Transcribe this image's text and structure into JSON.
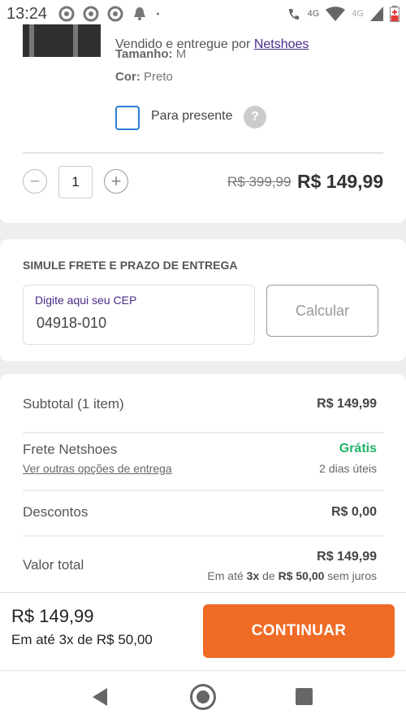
{
  "status_bar": {
    "time": "13:24",
    "network_label_1": "4G",
    "network_label_2": "4G",
    "icons": [
      "chrome-icon",
      "chrome-icon",
      "chrome-icon",
      "notification-bell-icon",
      "dot-icon",
      "wifi-call-icon",
      "wifi-icon",
      "signal-icon",
      "battery-low-icon"
    ]
  },
  "product": {
    "seller_prefix": "Vendido e entregue por ",
    "seller_name": "Netshoes",
    "size_label": "Tamanho:",
    "size_value": "M",
    "color_label": "Cor:",
    "color_value": "Preto",
    "gift_label": "Para presente",
    "help_symbol": "?",
    "quantity": "1",
    "old_price": "R$ 399,99",
    "new_price": "R$ 149,99"
  },
  "shipping": {
    "title": "SIMULE FRETE E PRAZO DE ENTREGA",
    "cep_label": "Digite aqui seu CEP",
    "cep_value": "04918-010",
    "calc_button": "Calcular"
  },
  "summary": {
    "subtotal_label": "Subtotal (1 item)",
    "subtotal_value": "R$ 149,99",
    "shipping_label": "Frete Netshoes",
    "shipping_value": "Grátis",
    "shipping_link": "Ver outras opções de entrega",
    "shipping_eta": "2 dias úteis",
    "discount_label": "Descontos",
    "discount_value": "R$ 0,00",
    "total_label": "Valor total",
    "total_value": "R$ 149,99",
    "install_prefix": "Em até ",
    "install_count": "3x",
    "install_mid": " de ",
    "install_amount": "R$ 50,00",
    "install_suffix": " sem juros"
  },
  "footer": {
    "price": "R$ 149,99",
    "installments": "Em até 3x de R$ 50,00",
    "continue_button": "CONTINUAR"
  },
  "colors": {
    "accent_orange": "#f06b25",
    "free_green": "#1fb467",
    "link_purple": "#4b2a88",
    "checkbox_blue": "#2b7bd6"
  }
}
